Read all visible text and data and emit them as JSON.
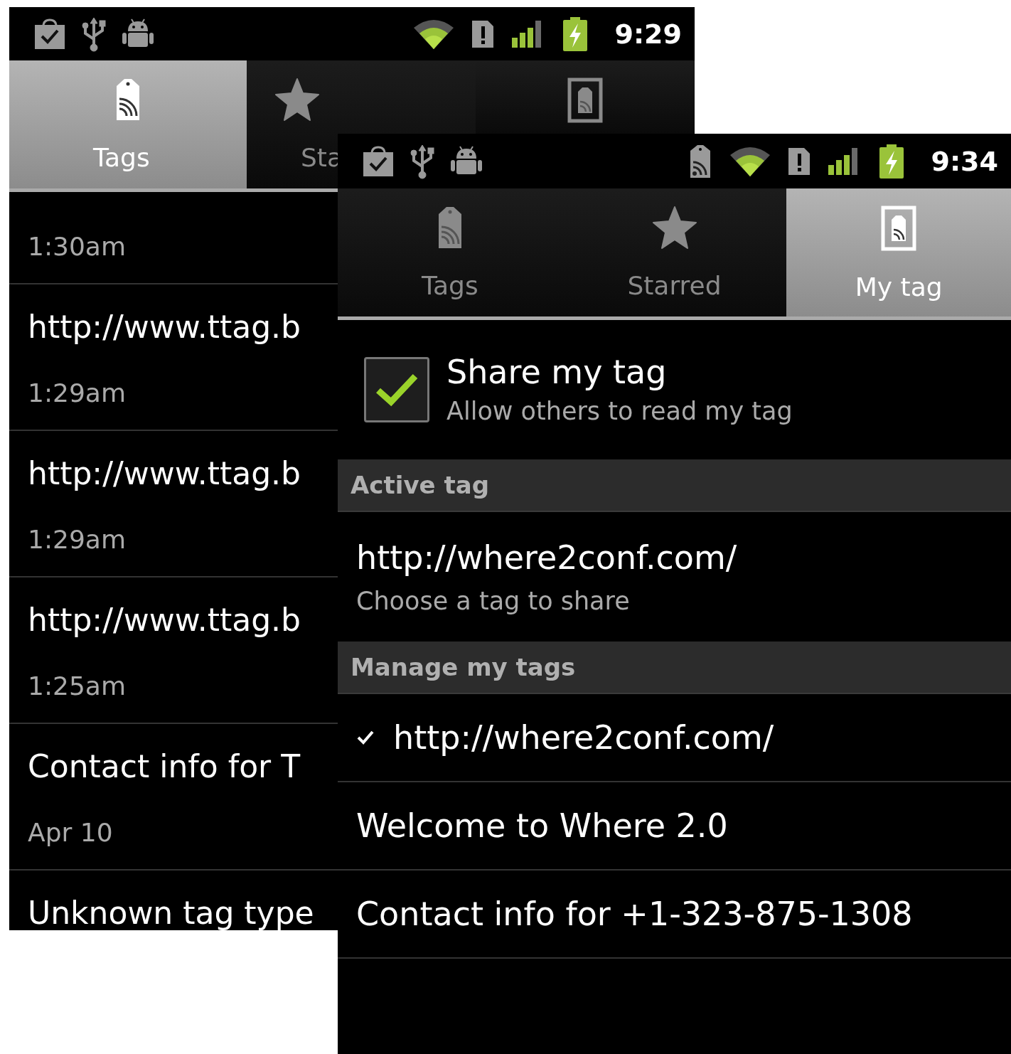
{
  "screens": [
    {
      "status_bar": {
        "time": "9:29"
      },
      "tabs": [
        {
          "label": "Tags",
          "selected": true
        },
        {
          "label": "Sta",
          "selected": false
        },
        {
          "selected": false
        }
      ],
      "list": [
        {
          "subtitle": "1:30am"
        },
        {
          "title": "http://www.ttag.b",
          "subtitle": "1:29am"
        },
        {
          "title": "http://www.ttag.b",
          "subtitle": "1:29am"
        },
        {
          "title": "http://www.ttag.b",
          "subtitle": "1:25am"
        },
        {
          "title": "Contact info for T",
          "subtitle": "Apr 10"
        },
        {
          "title": "Unknown tag type"
        }
      ]
    },
    {
      "status_bar": {
        "time": "9:34"
      },
      "tabs": [
        {
          "label": "Tags",
          "selected": false
        },
        {
          "label": "Starred",
          "selected": false
        },
        {
          "label": "My tag",
          "selected": true
        }
      ],
      "share": {
        "title": "Share my tag",
        "summary": "Allow others to read my tag",
        "checked": true
      },
      "sections": [
        {
          "header": "Active tag",
          "items": [
            {
              "title": "http://where2conf.com/",
              "summary": "Choose a tag to share"
            }
          ]
        },
        {
          "header": "Manage my tags",
          "items": [
            {
              "title": "http://where2conf.com/",
              "checked": true
            },
            {
              "title": "Welcome to Where 2.0",
              "checked": false
            },
            {
              "title": "Contact info for +1-323-875-1308",
              "checked": false
            }
          ]
        }
      ]
    }
  ]
}
